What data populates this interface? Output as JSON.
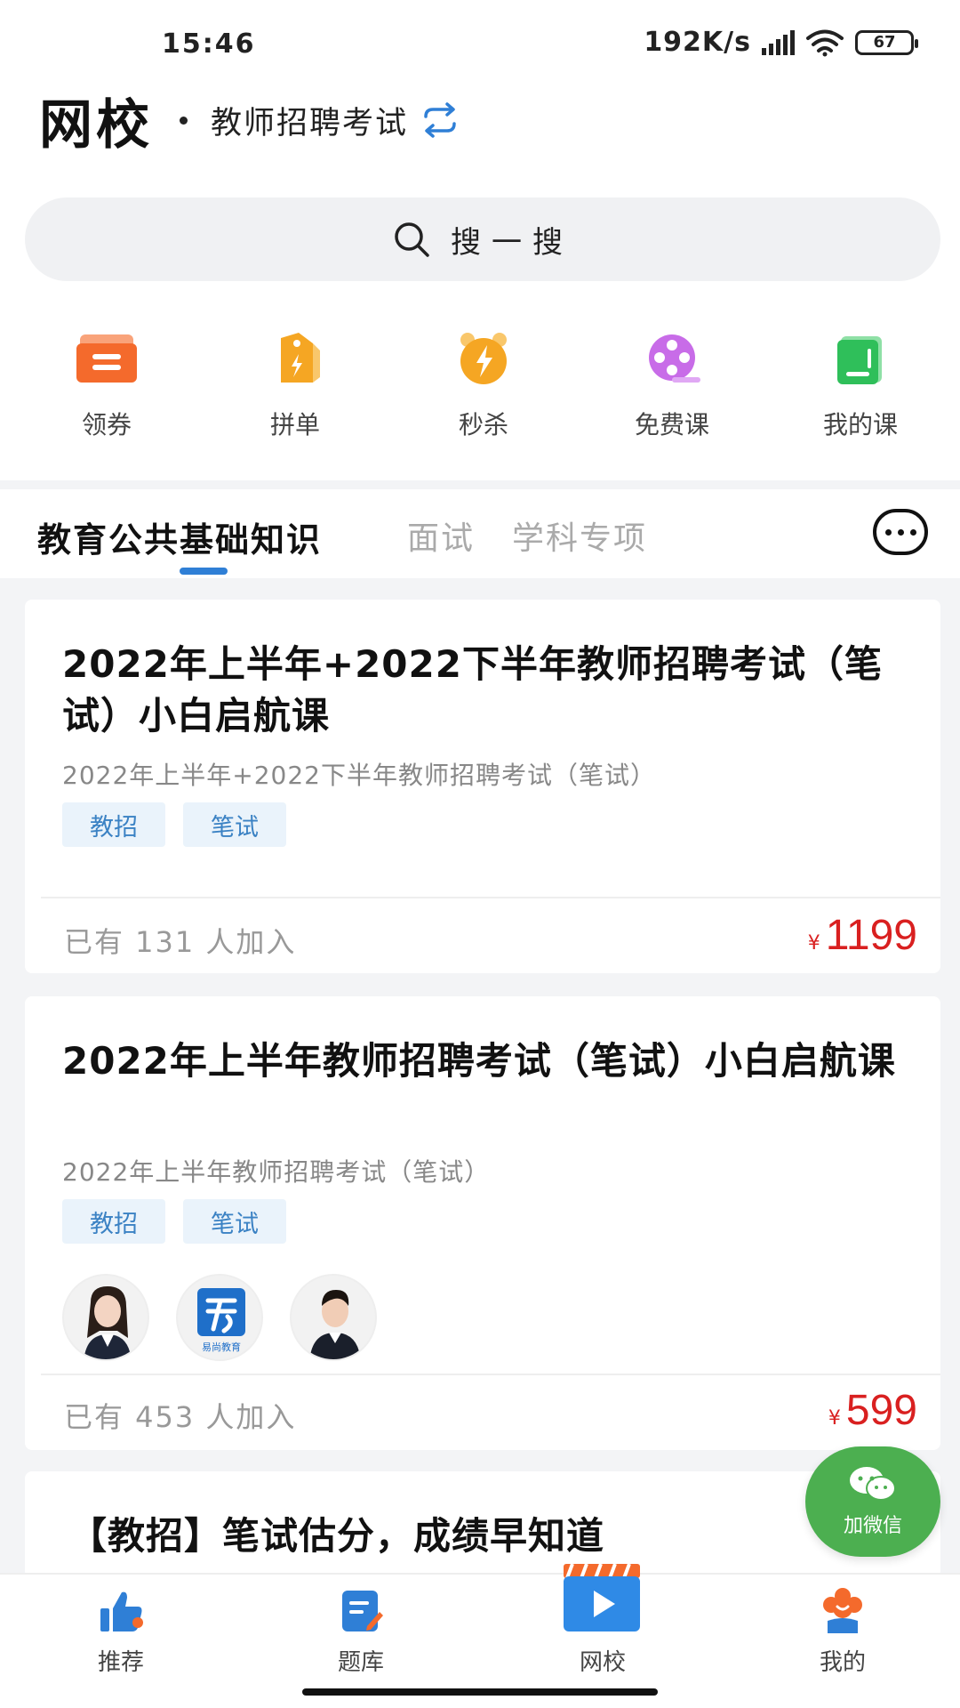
{
  "status_bar": {
    "time": "15:46",
    "net_speed": "192K/s",
    "battery": "67"
  },
  "header": {
    "app_title": "网校",
    "exam_category": "教师招聘考试"
  },
  "search": {
    "placeholder": "搜一搜"
  },
  "quick_entries": [
    {
      "label": "领券",
      "icon": "coupon-icon",
      "color": "#f46a2c"
    },
    {
      "label": "拼单",
      "icon": "group-buy-icon",
      "color": "#f5a623"
    },
    {
      "label": "秒杀",
      "icon": "alarm-clock-icon",
      "color": "#f5a623"
    },
    {
      "label": "免费课",
      "icon": "film-reel-icon",
      "color": "#c86ce8"
    },
    {
      "label": "我的课",
      "icon": "book-icon",
      "color": "#2fbf5a"
    }
  ],
  "tabs": [
    {
      "label": "教育公共基础知识",
      "active": true
    },
    {
      "label": "面试",
      "active": false
    },
    {
      "label": "学科专项",
      "active": false
    }
  ],
  "courses": [
    {
      "title": "2022年上半年+2022下半年教师招聘考试（笔试）小白启航课",
      "subtitle": "2022年上半年+2022下半年教师招聘考试（笔试）",
      "tags": [
        "教招",
        "笔试"
      ],
      "enrolled": "已有 131 人加入",
      "price_symbol": "¥",
      "price": "1199"
    },
    {
      "title": "2022年上半年教师招聘考试（笔试）小白启航课",
      "subtitle": "2022年上半年教师招聘考试（笔试）",
      "tags": [
        "教招",
        "笔试"
      ],
      "enrolled": "已有 453 人加入",
      "price_symbol": "¥",
      "price": "599"
    },
    {
      "title": "【教招】笔试估分，成绩早知道"
    }
  ],
  "teacher_logo_text": "易尚教育",
  "wechat": {
    "label": "加微信"
  },
  "bottom_nav": [
    {
      "label": "推荐",
      "icon": "thumbs-up-icon"
    },
    {
      "label": "题库",
      "icon": "question-bank-icon"
    },
    {
      "label": "网校",
      "icon": "video-play-icon",
      "active": true
    },
    {
      "label": "我的",
      "icon": "flower-profile-icon"
    }
  ],
  "colors": {
    "accent_blue": "#2f7fd6",
    "price_red": "#d92020",
    "wechat_green": "#4caf50",
    "tag_bg": "#eaf3fb",
    "tag_text": "#3b82c4"
  }
}
